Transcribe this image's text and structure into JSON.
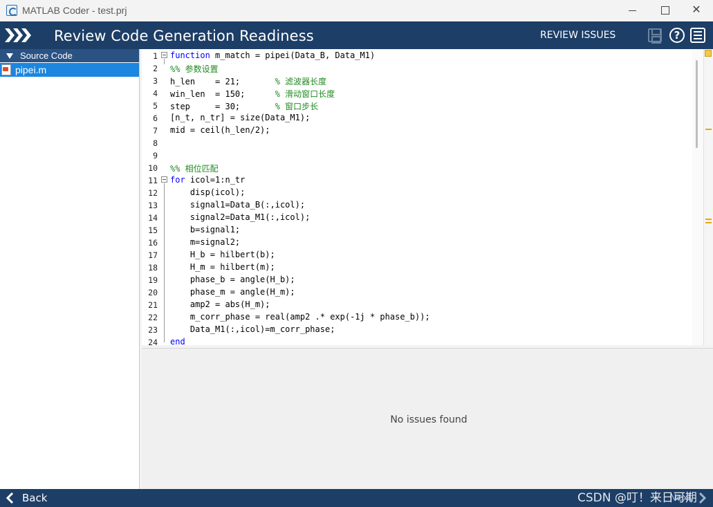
{
  "window": {
    "title": "MATLAB Coder - test.prj"
  },
  "header": {
    "title": "Review Code Generation Readiness",
    "review_issues": "REVIEW ISSUES"
  },
  "sidebar": {
    "section_label": "Source Code",
    "files": [
      {
        "name": "pipei.m"
      }
    ]
  },
  "editor": {
    "lines": [
      {
        "n": "1",
        "text": "function m_match = pipei(Data_B, Data_M1)"
      },
      {
        "n": "2",
        "text": "%% 参数设置"
      },
      {
        "n": "3",
        "text": "h_len    = 21;       % 滤波器长度"
      },
      {
        "n": "4",
        "text": "win_len  = 150;      % 滑动窗口长度"
      },
      {
        "n": "5",
        "text": "step     = 30;       % 窗口步长"
      },
      {
        "n": "6",
        "text": "[n_t, n_tr] = size(Data_M1);"
      },
      {
        "n": "7",
        "text": "mid = ceil(h_len/2);"
      },
      {
        "n": "8",
        "text": ""
      },
      {
        "n": "9",
        "text": ""
      },
      {
        "n": "10",
        "text": "%% 相位匹配"
      },
      {
        "n": "11",
        "text": "for icol=1:n_tr"
      },
      {
        "n": "12",
        "text": "    disp(icol);"
      },
      {
        "n": "13",
        "text": "    signal1=Data_B(:,icol);"
      },
      {
        "n": "14",
        "text": "    signal2=Data_M1(:,icol);"
      },
      {
        "n": "15",
        "text": "    b=signal1;"
      },
      {
        "n": "16",
        "text": "    m=signal2;"
      },
      {
        "n": "17",
        "text": "    H_b = hilbert(b);"
      },
      {
        "n": "18",
        "text": "    H_m = hilbert(m);"
      },
      {
        "n": "19",
        "text": "    phase_b = angle(H_b);"
      },
      {
        "n": "20",
        "text": "    phase_m = angle(H_m);"
      },
      {
        "n": "21",
        "text": "    amp2 = abs(H_m);"
      },
      {
        "n": "22",
        "text": "    m_corr_phase = real(amp2 .* exp(-1j * phase_b));"
      },
      {
        "n": "23",
        "text": "    Data_M1(:,icol)=m_corr_phase;"
      },
      {
        "n": "24",
        "text": "end"
      }
    ]
  },
  "issues": {
    "message": "No issues found"
  },
  "footer": {
    "back_label": "Back",
    "next_label": "Next"
  },
  "watermark": {
    "text": "CSDN @叮！来日可期"
  },
  "colors": {
    "header_bg": "#1d3e66",
    "sidebar_header_bg": "#2a5283",
    "selected_file_bg": "#1c86e0",
    "keyword": "#0000ff",
    "comment": "#228b22"
  }
}
